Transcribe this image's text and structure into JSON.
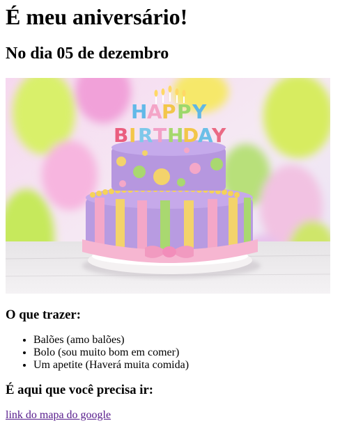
{
  "heading": "É meu aniversário!",
  "subheading": "No dia 05 de dezembro",
  "image": {
    "cake_topper": [
      "H",
      "A",
      "P",
      "P",
      "Y",
      "B",
      "I",
      "R",
      "T",
      "H",
      "D",
      "A",
      "Y"
    ]
  },
  "bring": {
    "title": "O que trazer:",
    "items": [
      "Balões (amo balões)",
      "Bolo (sou muito bom em comer)",
      "Um apetite (Haverá muita comida)"
    ]
  },
  "location": {
    "title": "É aqui que você precisa ir:",
    "link_text": "link do mapa do google"
  },
  "colors": {
    "link": "#551a8b",
    "cake_top": "#b79be0",
    "cake_stripe_pink": "#f4a7c8",
    "cake_stripe_yellow": "#f3d36b",
    "cake_stripe_green": "#a9d870"
  }
}
